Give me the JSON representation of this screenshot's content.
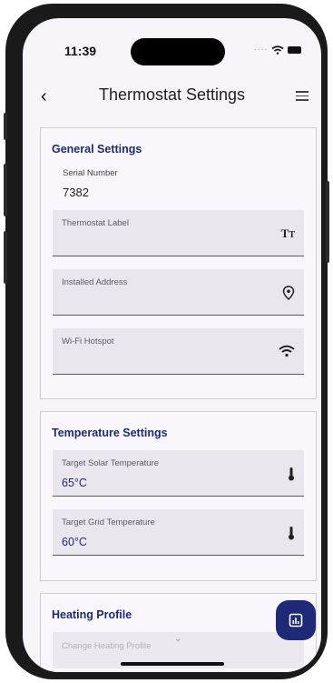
{
  "status_bar": {
    "time": "11:39"
  },
  "header": {
    "title": "Thermostat Settings"
  },
  "general": {
    "title": "General Settings",
    "serial_label": "Serial Number",
    "serial_value": "7382",
    "fields": [
      {
        "label": "Thermostat Label",
        "value": "",
        "icon": "text-size-icon"
      },
      {
        "label": "Installed Address",
        "value": "",
        "icon": "location-pin-icon"
      },
      {
        "label": "Wi-Fi Hotspot",
        "value": "",
        "icon": "wifi-icon"
      }
    ]
  },
  "temperature": {
    "title": "Temperature Settings",
    "fields": [
      {
        "label": "Target Solar Temperature",
        "value": "65°C",
        "icon": "thermometer-icon"
      },
      {
        "label": "Target Grid Temperature",
        "value": "60°C",
        "icon": "thermometer-icon"
      }
    ]
  },
  "heating": {
    "title": "Heating Profile",
    "dropdown_placeholder": "Change Heating Profile"
  },
  "fab": {
    "icon": "chart-icon"
  },
  "colors": {
    "accent": "#1e2a78",
    "field_bg": "#e9e6ee",
    "screen_bg": "#f7f4fa"
  }
}
